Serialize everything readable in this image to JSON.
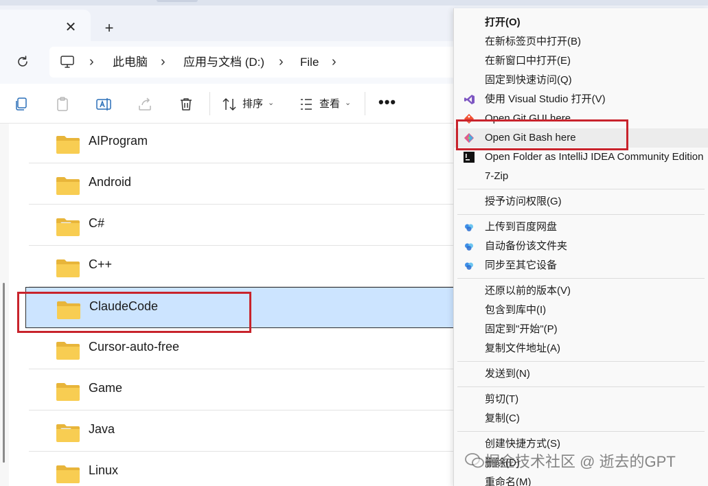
{
  "tabs": {
    "close_glyph": "✕",
    "new_tab_glyph": "+"
  },
  "address_bar": {
    "separator": "›",
    "crumbs": [
      "此电脑",
      "应用与文档 (D:)",
      "File"
    ]
  },
  "toolbar": {
    "sort_label": "排序",
    "view_label": "查看",
    "more_label": "•••",
    "caret": "⌄"
  },
  "files": [
    {
      "name": "AIProgram",
      "icon": "folder-icon"
    },
    {
      "name": "Android",
      "icon": "folder-icon"
    },
    {
      "name": "C#",
      "icon": "folder-with-document-icon"
    },
    {
      "name": "C++",
      "icon": "folder-icon"
    },
    {
      "name": "ClaudeCode",
      "icon": "folder-icon",
      "selected": true
    },
    {
      "name": "Cursor-auto-free",
      "icon": "folder-icon"
    },
    {
      "name": "Game",
      "icon": "folder-icon"
    },
    {
      "name": "Java",
      "icon": "folder-with-document-icon"
    },
    {
      "name": "Linux",
      "icon": "folder-icon"
    }
  ],
  "context_menu": {
    "items": [
      {
        "label": "打开(O)",
        "bold": true
      },
      {
        "label": "在新标签页中打开(B)"
      },
      {
        "label": "在新窗口中打开(E)"
      },
      {
        "label": "固定到快速访问(Q)"
      },
      {
        "label": "使用 Visual Studio 打开(V)",
        "icon": "visual-studio-icon"
      },
      {
        "label": "Open Git GUI here",
        "icon": "git-gui-icon"
      },
      {
        "label": "Open Git Bash here",
        "icon": "git-bash-icon",
        "hover": true
      },
      {
        "label": "Open Folder as IntelliJ IDEA Community Edition",
        "icon": "intellij-icon"
      },
      {
        "label": "7-Zip"
      },
      {
        "label": "授予访问权限(G)"
      },
      {
        "label": "上传到百度网盘",
        "icon": "baidu-netdisk-icon"
      },
      {
        "label": "自动备份该文件夹",
        "icon": "baidu-netdisk-icon"
      },
      {
        "label": "同步至其它设备",
        "icon": "baidu-netdisk-icon"
      },
      {
        "label": "还原以前的版本(V)"
      },
      {
        "label": "包含到库中(I)"
      },
      {
        "label": "固定到\"开始\"(P)"
      },
      {
        "label": "复制文件地址(A)"
      },
      {
        "label": "发送到(N)"
      },
      {
        "label": "剪切(T)"
      },
      {
        "label": "复制(C)"
      },
      {
        "label": "创建快捷方式(S)"
      },
      {
        "label": "删除(D)"
      },
      {
        "label": "重命名(M)"
      }
    ]
  },
  "watermark": {
    "text": "掘金技术社区 @ 逝去的GPT"
  },
  "colors": {
    "folder": "#f5c542",
    "selection": "#cce4ff",
    "highlight_box": "#c8232c"
  }
}
